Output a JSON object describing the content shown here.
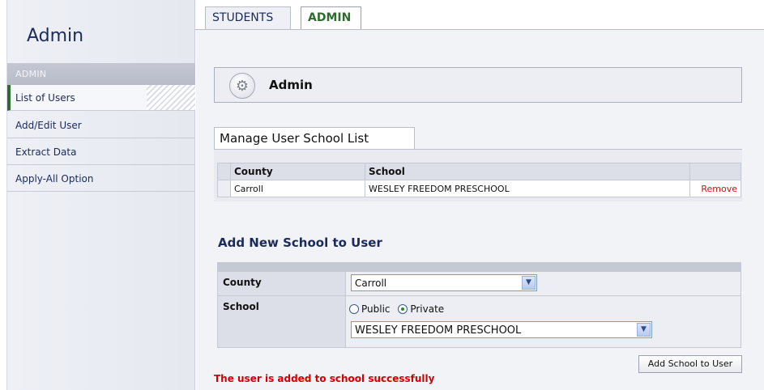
{
  "sidebar": {
    "title": "Admin",
    "section": "ADMIN",
    "items": [
      {
        "label": "List of Users"
      },
      {
        "label": "Add/Edit User"
      },
      {
        "label": "Extract Data"
      },
      {
        "label": "Apply-All Option"
      }
    ]
  },
  "tabs": [
    {
      "label": "STUDENTS"
    },
    {
      "label": "ADMIN"
    }
  ],
  "header": {
    "title": "Admin",
    "icon": "gear-icon"
  },
  "manage": {
    "title": "Manage User School List",
    "columns": [
      "County",
      "School"
    ],
    "rows": [
      {
        "county": "Carroll",
        "school": "WESLEY FREEDOM PRESCHOOL",
        "action": "Remove"
      }
    ]
  },
  "add_school": {
    "heading": "Add New School to User",
    "county_label": "County",
    "county_value": "Carroll",
    "school_label": "School",
    "radio_public": "Public",
    "radio_private": "Private",
    "selected_type": "Private",
    "school_value": "WESLEY FREEDOM PRESCHOOL",
    "button_label": "Add School to User"
  },
  "status_message": "The user is added to school successfully",
  "colors": {
    "accent_green": "#2e6b2e",
    "error_red": "#d40000",
    "nav_text": "#1a2a5a"
  }
}
